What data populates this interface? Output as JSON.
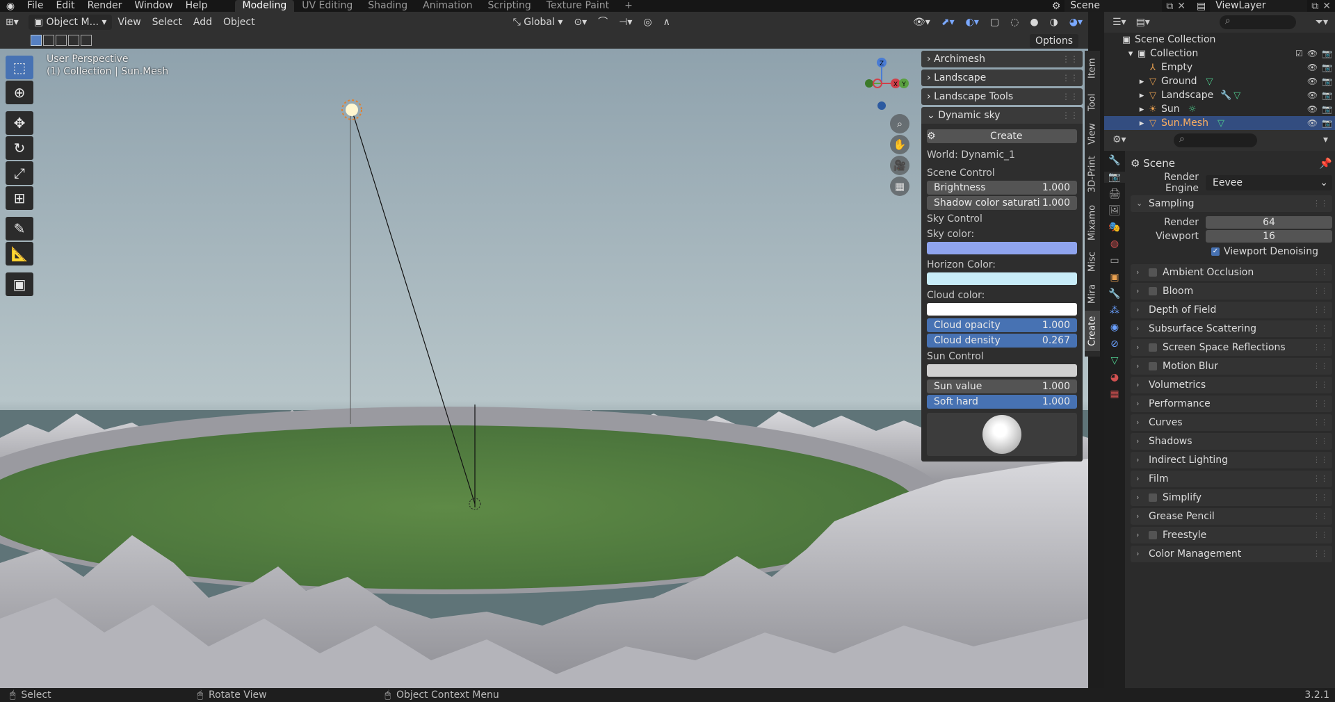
{
  "topbar": {
    "menu": [
      "File",
      "Edit",
      "Render",
      "Window",
      "Help"
    ],
    "workspaces": [
      "Modeling",
      "UV Editing",
      "Shading",
      "Animation",
      "Scripting",
      "Texture Paint"
    ],
    "add_tab": "+",
    "scene_name": "Scene",
    "view_layer": "ViewLayer"
  },
  "header": {
    "mode": "Object M...",
    "menus": [
      "View",
      "Select",
      "Add",
      "Object"
    ],
    "transform_orientation": "Global",
    "options_label": "Options"
  },
  "viewport": {
    "perspective": "User Perspective",
    "context": "(1) Collection | Sun.Mesh"
  },
  "gizmo": {
    "x": "X",
    "y": "Y",
    "z": "Z"
  },
  "npanel": {
    "panels": [
      "Archimesh",
      "Landscape",
      "Landscape Tools"
    ],
    "dynamic_sky": {
      "title": "Dynamic sky",
      "create": "Create",
      "world": "World: Dynamic_1",
      "scene_control": "Scene Control",
      "brightness_label": "Brightness",
      "brightness": "1.000",
      "shadow_label": "Shadow color saturati",
      "shadow": "1.000",
      "sky_control": "Sky Control",
      "sky_color": "Sky color:",
      "horizon_color": "Horizon Color:",
      "cloud_color": "Cloud color:",
      "cloud_opacity_label": "Cloud opacity",
      "cloud_opacity": "1.000",
      "cloud_density_label": "Cloud density",
      "cloud_density": "0.267",
      "sun_control": "Sun Control",
      "sun_value_label": "Sun value",
      "sun_value": "1.000",
      "soft_hard_label": "Soft hard",
      "soft_hard": "1.000"
    },
    "colors": {
      "sky": "#8fa4ee",
      "horizon": "#c8ecf8",
      "cloud": "#ffffff",
      "sun": "#d0d0d0"
    },
    "tabs": [
      "Item",
      "Tool",
      "View",
      "3D-Print",
      "Mixamo",
      "Misc",
      "Mira",
      "Create"
    ]
  },
  "outliner": {
    "root": "Scene Collection",
    "collection": "Collection",
    "items": [
      "Empty",
      "Ground",
      "Landscape",
      "Sun",
      "Sun.Mesh"
    ]
  },
  "properties": {
    "scene_title": "Scene",
    "render_engine_label": "Render Engine",
    "render_engine": "Eevee",
    "sampling": "Sampling",
    "render_label": "Render",
    "render_samples": "64",
    "viewport_label": "Viewport",
    "viewport_samples": "16",
    "denoise": "Viewport Denoising",
    "sections_cb": [
      "Ambient Occlusion",
      "Bloom"
    ],
    "section_dof": "Depth of Field",
    "section_sss": "Subsurface Scattering",
    "section_ssr": "Screen Space Reflections",
    "section_mb": "Motion Blur",
    "sections_plain1": [
      "Volumetrics",
      "Performance",
      "Curves",
      "Shadows",
      "Indirect Lighting",
      "Film"
    ],
    "section_simplify": "Simplify",
    "section_gp": "Grease Pencil",
    "section_freestyle": "Freestyle",
    "section_cm": "Color Management"
  },
  "status": {
    "select": "Select",
    "rotate": "Rotate View",
    "context_menu": "Object Context Menu",
    "version": "3.2.1"
  }
}
